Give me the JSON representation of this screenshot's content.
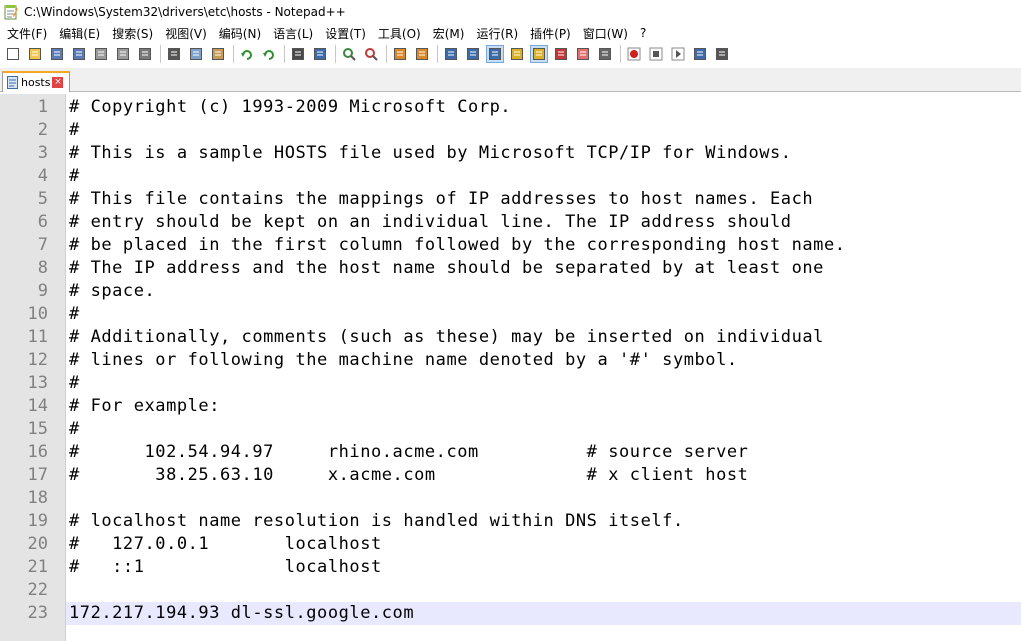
{
  "window": {
    "title": "C:\\Windows\\System32\\drivers\\etc\\hosts - Notepad++",
    "app_icon": "notepad-plus-plus-icon"
  },
  "menu": [
    {
      "label": "文件(F)"
    },
    {
      "label": "编辑(E)"
    },
    {
      "label": "搜索(S)"
    },
    {
      "label": "视图(V)"
    },
    {
      "label": "编码(N)"
    },
    {
      "label": "语言(L)"
    },
    {
      "label": "设置(T)"
    },
    {
      "label": "工具(O)"
    },
    {
      "label": "宏(M)"
    },
    {
      "label": "运行(R)"
    },
    {
      "label": "插件(P)"
    },
    {
      "label": "窗口(W)"
    },
    {
      "label": "?"
    }
  ],
  "toolbar": {
    "groups": [
      [
        "new-file-icon",
        "open-file-icon",
        "save-icon",
        "save-all-icon",
        "close-icon",
        "close-all-icon",
        "print-icon"
      ],
      [
        "cut-icon",
        "copy-icon",
        "paste-icon"
      ],
      [
        "undo-icon",
        "redo-icon"
      ],
      [
        "find-icon",
        "replace-icon"
      ],
      [
        "zoom-in-icon",
        "zoom-out-icon"
      ],
      [
        "sync-vertical-icon",
        "sync-horizontal-icon"
      ],
      [
        "word-wrap-icon",
        "show-all-chars-icon",
        "indent-guide-icon",
        "udl-icon",
        "doc-map-icon",
        "function-list-icon",
        "folder-workspace-icon",
        "monitoring-icon"
      ],
      [
        "record-macro-icon",
        "stop-record-icon",
        "play-macro-icon",
        "run-macro-multiple-icon",
        "save-macro-icon"
      ]
    ],
    "active": [
      "indent-guide-icon",
      "doc-map-icon"
    ]
  },
  "tabs": [
    {
      "label": "hosts",
      "icon": "file-icon",
      "close": "×"
    }
  ],
  "editor": {
    "current_line": 23,
    "lines": [
      {
        "num": "1",
        "text": "# Copyright (c) 1993-2009 Microsoft Corp."
      },
      {
        "num": "2",
        "text": "#"
      },
      {
        "num": "3",
        "text": "# This is a sample HOSTS file used by Microsoft TCP/IP for Windows."
      },
      {
        "num": "4",
        "text": "#"
      },
      {
        "num": "5",
        "text": "# This file contains the mappings of IP addresses to host names. Each"
      },
      {
        "num": "6",
        "text": "# entry should be kept on an individual line. The IP address should"
      },
      {
        "num": "7",
        "text": "# be placed in the first column followed by the corresponding host name."
      },
      {
        "num": "8",
        "text": "# The IP address and the host name should be separated by at least one"
      },
      {
        "num": "9",
        "text": "# space."
      },
      {
        "num": "10",
        "text": "#"
      },
      {
        "num": "11",
        "text": "# Additionally, comments (such as these) may be inserted on individual"
      },
      {
        "num": "12",
        "text": "# lines or following the machine name denoted by a '#' symbol."
      },
      {
        "num": "13",
        "text": "#"
      },
      {
        "num": "14",
        "text": "# For example:"
      },
      {
        "num": "15",
        "text": "#"
      },
      {
        "num": "16",
        "text": "#      102.54.94.97     rhino.acme.com          # source server"
      },
      {
        "num": "17",
        "text": "#       38.25.63.10     x.acme.com              # x client host"
      },
      {
        "num": "18",
        "text": ""
      },
      {
        "num": "19",
        "text": "# localhost name resolution is handled within DNS itself."
      },
      {
        "num": "20",
        "text": "#   127.0.0.1       localhost"
      },
      {
        "num": "21",
        "text": "#   ::1             localhost"
      },
      {
        "num": "22",
        "text": ""
      },
      {
        "num": "23",
        "text": "172.217.194.93 dl-ssl.google.com"
      }
    ]
  }
}
